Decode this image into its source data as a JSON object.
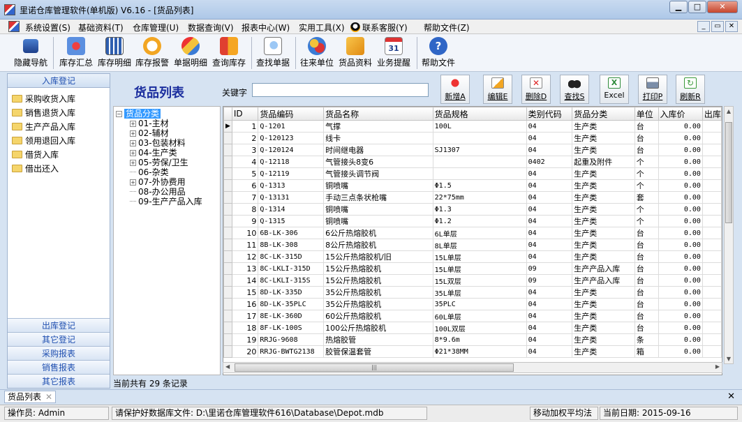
{
  "window": {
    "title": "里诺仓库管理软件(单机版) V6.16 - [货品列表]"
  },
  "menu": [
    "系统设置(S)",
    "基础资料(T)",
    "仓库管理(U)",
    "数据查询(V)",
    "报表中心(W)",
    "实用工具(X)",
    "联系客服(Y)",
    "帮助文件(Z)"
  ],
  "toolbar": [
    "隐藏导航",
    "库存汇总",
    "库存明细",
    "库存报警",
    "单据明细",
    "查询库存",
    "查找单据",
    "往来单位",
    "货品资料",
    "业务提醒",
    "帮助文件"
  ],
  "calendar_day": "31",
  "left_panel": {
    "header": "入库登记",
    "items": [
      "采购收货入库",
      "销售退货入库",
      "生产产品入库",
      "领用退回入库",
      "借货入库",
      "借出还入"
    ],
    "bottom": [
      "出库登记",
      "其它登记",
      "采购报表",
      "销售报表",
      "其它报表"
    ]
  },
  "main": {
    "title": "货品列表",
    "keyword_label": "关键字",
    "keyword_value": "",
    "actions": [
      "新增A",
      "编辑E",
      "删除D",
      "查找S",
      "Excel",
      "打印P",
      "刷新R"
    ]
  },
  "tree": {
    "root": "货品分类",
    "children": [
      {
        "label": "01-主材",
        "expandable": true
      },
      {
        "label": "02-辅材",
        "expandable": true
      },
      {
        "label": "03-包装材料",
        "expandable": true
      },
      {
        "label": "04-生产类",
        "expandable": true
      },
      {
        "label": "05-劳保/卫生",
        "expandable": true
      },
      {
        "label": "06-杂类",
        "expandable": false
      },
      {
        "label": "07-外协费用",
        "expandable": true
      },
      {
        "label": "08-办公用品",
        "expandable": false
      },
      {
        "label": "09-生产产品入库",
        "expandable": false
      }
    ]
  },
  "table": {
    "columns": [
      "ID",
      "货品编码",
      "货品名称",
      "货品规格",
      "类别代码",
      "货品分类",
      "单位",
      "入库价",
      "出库"
    ],
    "rows": [
      [
        "1",
        "Q-1201",
        "气撑",
        "100L",
        "04",
        "生产类",
        "台",
        "0.00"
      ],
      [
        "2",
        "Q-120123",
        "线卡",
        "",
        "04",
        "生产类",
        "台",
        "0.00"
      ],
      [
        "3",
        "Q-120124",
        "时间继电器",
        "SJ1307",
        "04",
        "生产类",
        "台",
        "0.00"
      ],
      [
        "4",
        "Q-12118",
        "气管接头8变6",
        "",
        "0402",
        "起重及附件",
        "个",
        "0.00"
      ],
      [
        "5",
        "Q-12119",
        "气管接头调节阀",
        "",
        "04",
        "生产类",
        "个",
        "0.00"
      ],
      [
        "6",
        "Q-1313",
        "铜喷嘴",
        "Φ1.5",
        "04",
        "生产类",
        "个",
        "0.00"
      ],
      [
        "7",
        "Q-13131",
        "手动三点条状枪嘴",
        "22*75mm",
        "04",
        "生产类",
        "套",
        "0.00"
      ],
      [
        "8",
        "Q-1314",
        "铜喷嘴",
        "Φ1.3",
        "04",
        "生产类",
        "个",
        "0.00"
      ],
      [
        "9",
        "Q-1315",
        "铜喷嘴",
        "Φ1.2",
        "04",
        "生产类",
        "个",
        "0.00"
      ],
      [
        "10",
        "6B-LK-306",
        "6公斤热熔胶机",
        "6L单层",
        "04",
        "生产类",
        "台",
        "0.00"
      ],
      [
        "11",
        "8B-LK-308",
        "8公斤热熔胶机",
        "8L单层",
        "04",
        "生产类",
        "台",
        "0.00"
      ],
      [
        "12",
        "8C-LK-315D",
        "15公斤热熔胶机/旧",
        "15L单层",
        "04",
        "生产类",
        "台",
        "0.00"
      ],
      [
        "13",
        "8C-LKLI-315D",
        "15公斤热熔胶机",
        "15L单层",
        "09",
        "生产产品入库",
        "台",
        "0.00"
      ],
      [
        "14",
        "8C-LKLI-315S",
        "15公斤热熔胶机",
        "15L双层",
        "09",
        "生产产品入库",
        "台",
        "0.00"
      ],
      [
        "15",
        "8D-LK-335D",
        "35公斤热熔胶机",
        "35L单层",
        "04",
        "生产类",
        "台",
        "0.00"
      ],
      [
        "16",
        "8D-LK-35PLC",
        "35公斤热熔胶机",
        "35PLC",
        "04",
        "生产类",
        "台",
        "0.00"
      ],
      [
        "17",
        "8E-LK-360D",
        "60公斤热熔胶机",
        "60L单层",
        "04",
        "生产类",
        "台",
        "0.00"
      ],
      [
        "18",
        "8F-LK-100S",
        "100公斤热熔胶机",
        "100L双层",
        "04",
        "生产类",
        "台",
        "0.00"
      ],
      [
        "19",
        "RRJG-9608",
        "热熔胶管",
        "8*9.6m",
        "04",
        "生产类",
        "条",
        "0.00"
      ],
      [
        "20",
        "RRJG-BWTG2138",
        "胶管保温套管",
        "Φ21*38MM",
        "04",
        "生产类",
        "箱",
        "0.00"
      ]
    ]
  },
  "records_text": "当前共有 29 条记录",
  "doc_tab": "货品列表",
  "status": {
    "operator": "操作员: Admin",
    "db_hint": "请保护好数据库文件: D:\\里诺仓库管理软件616\\Database\\Depot.mdb",
    "cost_method": "移动加权平均法",
    "date": "当前日期: 2015-09-16"
  }
}
